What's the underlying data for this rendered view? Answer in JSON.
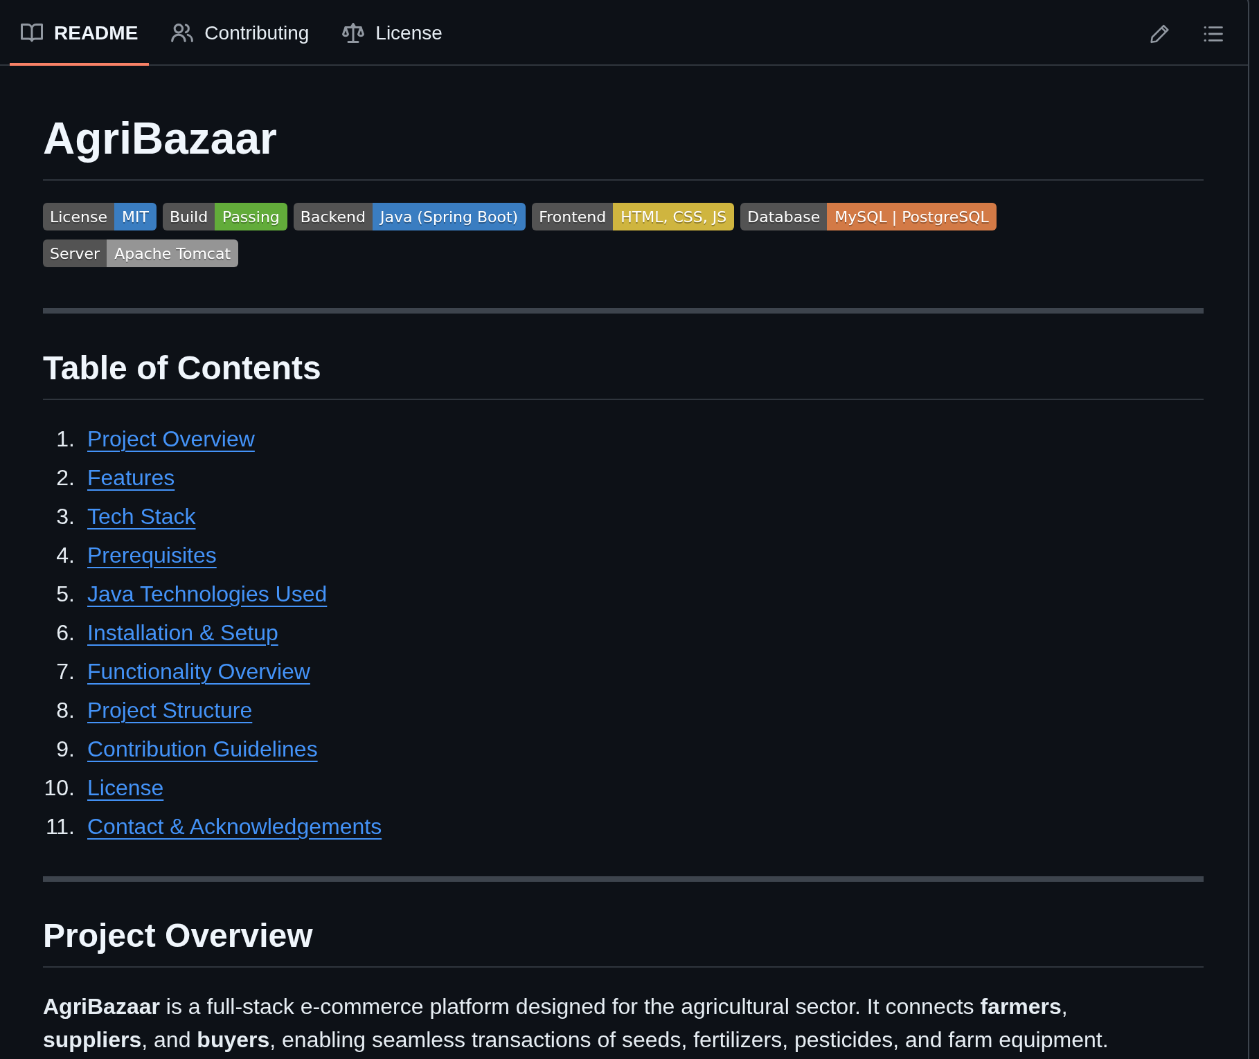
{
  "tabs": [
    {
      "label": "README",
      "kind": "readme",
      "selected": true
    },
    {
      "label": "Contributing",
      "kind": "contributing",
      "selected": false
    },
    {
      "label": "License",
      "kind": "license",
      "selected": false
    }
  ],
  "title": "AgriBazaar",
  "badges": [
    {
      "label": "License",
      "value": "MIT",
      "color": "#3a7dc1"
    },
    {
      "label": "Build",
      "value": "Passing",
      "color": "#62ac3a"
    },
    {
      "label": "Backend",
      "value": "Java (Spring Boot)",
      "color": "#3a7dc1"
    },
    {
      "label": "Frontend",
      "value": "HTML, CSS, JS",
      "color": "#cfb53f"
    },
    {
      "label": "Database",
      "value": "MySQL | PostgreSQL",
      "color": "#d37a46"
    },
    {
      "label": "Server",
      "value": "Apache Tomcat",
      "color": "#959595"
    }
  ],
  "toc": {
    "heading": "Table of Contents",
    "items": [
      {
        "number": "1.",
        "label": "Project Overview"
      },
      {
        "number": "2.",
        "label": "Features"
      },
      {
        "number": "3.",
        "label": "Tech Stack"
      },
      {
        "number": "4.",
        "label": "Prerequisites"
      },
      {
        "number": "5.",
        "label": "Java Technologies Used"
      },
      {
        "number": "6.",
        "label": "Installation & Setup"
      },
      {
        "number": "7.",
        "label": "Functionality Overview"
      },
      {
        "number": "8.",
        "label": "Project Structure"
      },
      {
        "number": "9.",
        "label": "Contribution Guidelines"
      },
      {
        "number": "10.",
        "label": "License"
      },
      {
        "number": "11.",
        "label": "Contact & Acknowledgements"
      }
    ]
  },
  "overview": {
    "heading": "Project Overview",
    "text": "**AgriBazaar** is a full-stack e-commerce platform designed for the agricultural sector. It connects **farmers**, **suppliers**, and **buyers**, enabling seamless transactions of seeds, fertilizers, pesticides, and farm equipment."
  }
}
